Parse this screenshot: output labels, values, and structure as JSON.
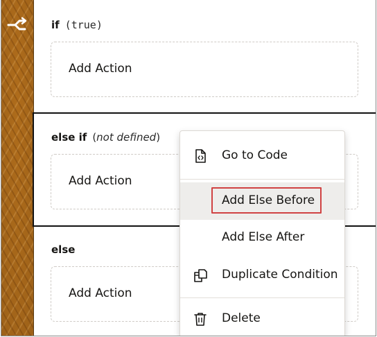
{
  "conditions": [
    {
      "keyword": "if",
      "expression": "(true)",
      "action_label": "Add Action"
    },
    {
      "keyword": "else if",
      "expression_prefix": "(",
      "expression_italic": "not defined",
      "expression_suffix": ")",
      "action_label": "Add Action"
    },
    {
      "keyword": "else",
      "action_label": "Add Action"
    }
  ],
  "context_menu": {
    "items": [
      {
        "label": "Go to Code",
        "icon": "code-file-icon"
      },
      {
        "label": "Add Else Before",
        "icon": ""
      },
      {
        "label": "Add Else After",
        "icon": ""
      },
      {
        "label": "Duplicate Condition",
        "icon": "duplicate-icon"
      },
      {
        "label": "Delete",
        "icon": "trash-icon"
      }
    ],
    "hovered_item": "Add Else Before"
  },
  "rail": {
    "icon": "branch-icon"
  },
  "colors": {
    "rail": "#b8721d",
    "selection_border": "#111111",
    "hover_background": "#eeedeb",
    "focus_outline": "#d04242"
  }
}
